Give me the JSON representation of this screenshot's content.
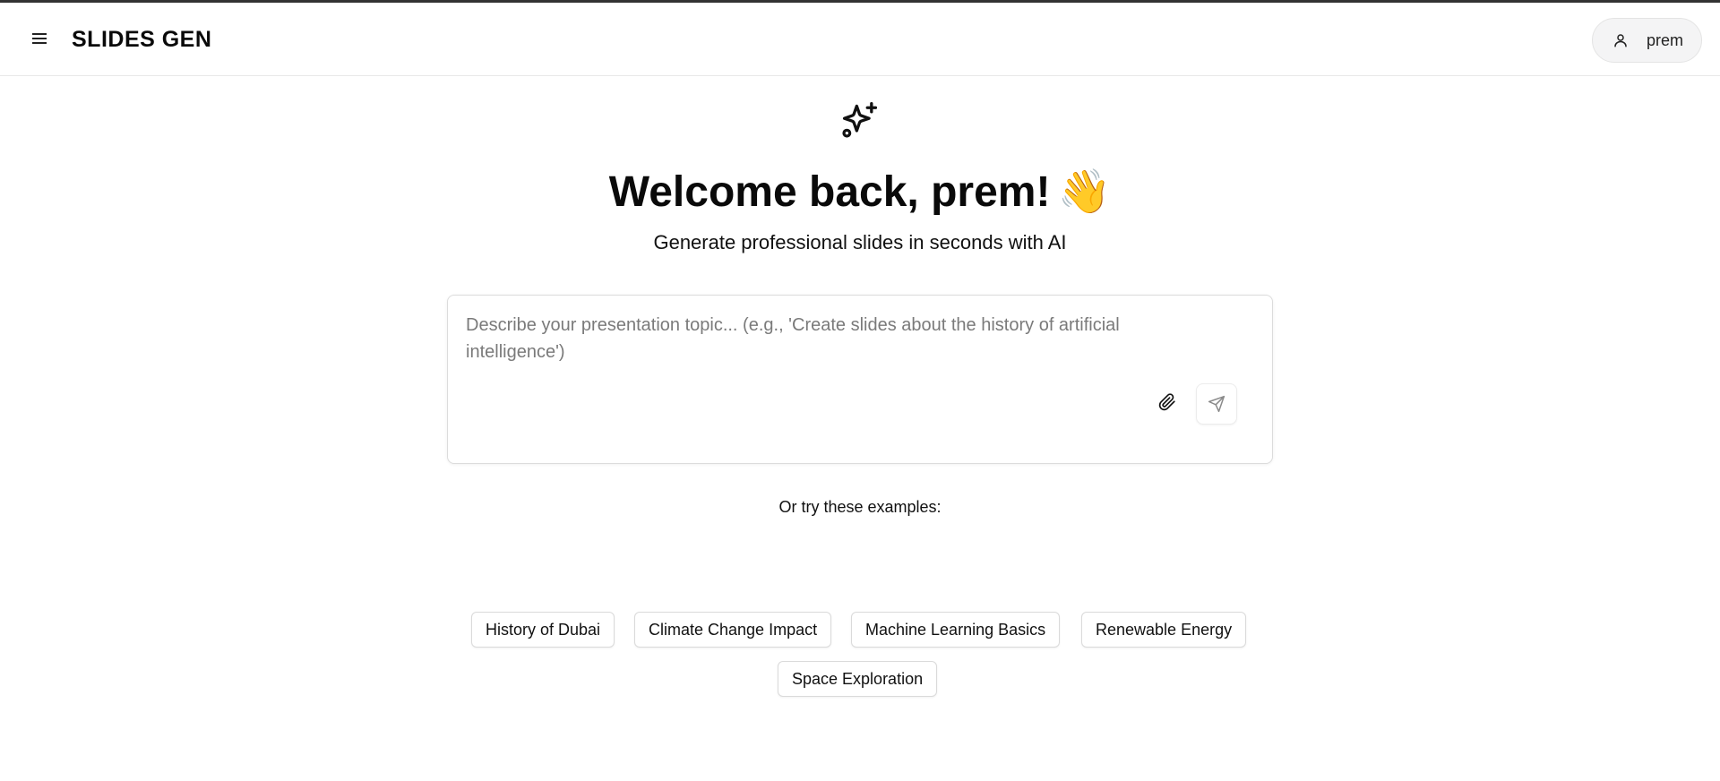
{
  "header": {
    "brand": "SLIDES GEN",
    "user_name": "prem"
  },
  "hero": {
    "title": "Welcome back, prem!",
    "title_emoji": "👋",
    "subtitle": "Generate professional slides in seconds with AI"
  },
  "prompt": {
    "placeholder": "Describe your presentation topic... (e.g., 'Create slides about the history of artificial intelligence')",
    "value": ""
  },
  "examples": {
    "label": "Or try these examples:",
    "items": [
      "History of Dubai",
      "Climate Change Impact",
      "Machine Learning Basics",
      "Renewable Energy",
      "Space Exploration"
    ]
  },
  "icons": {
    "menu": "menu-icon",
    "user": "user-icon",
    "sparkle": "sparkles-icon",
    "attach": "paperclip-icon",
    "send": "send-icon"
  }
}
